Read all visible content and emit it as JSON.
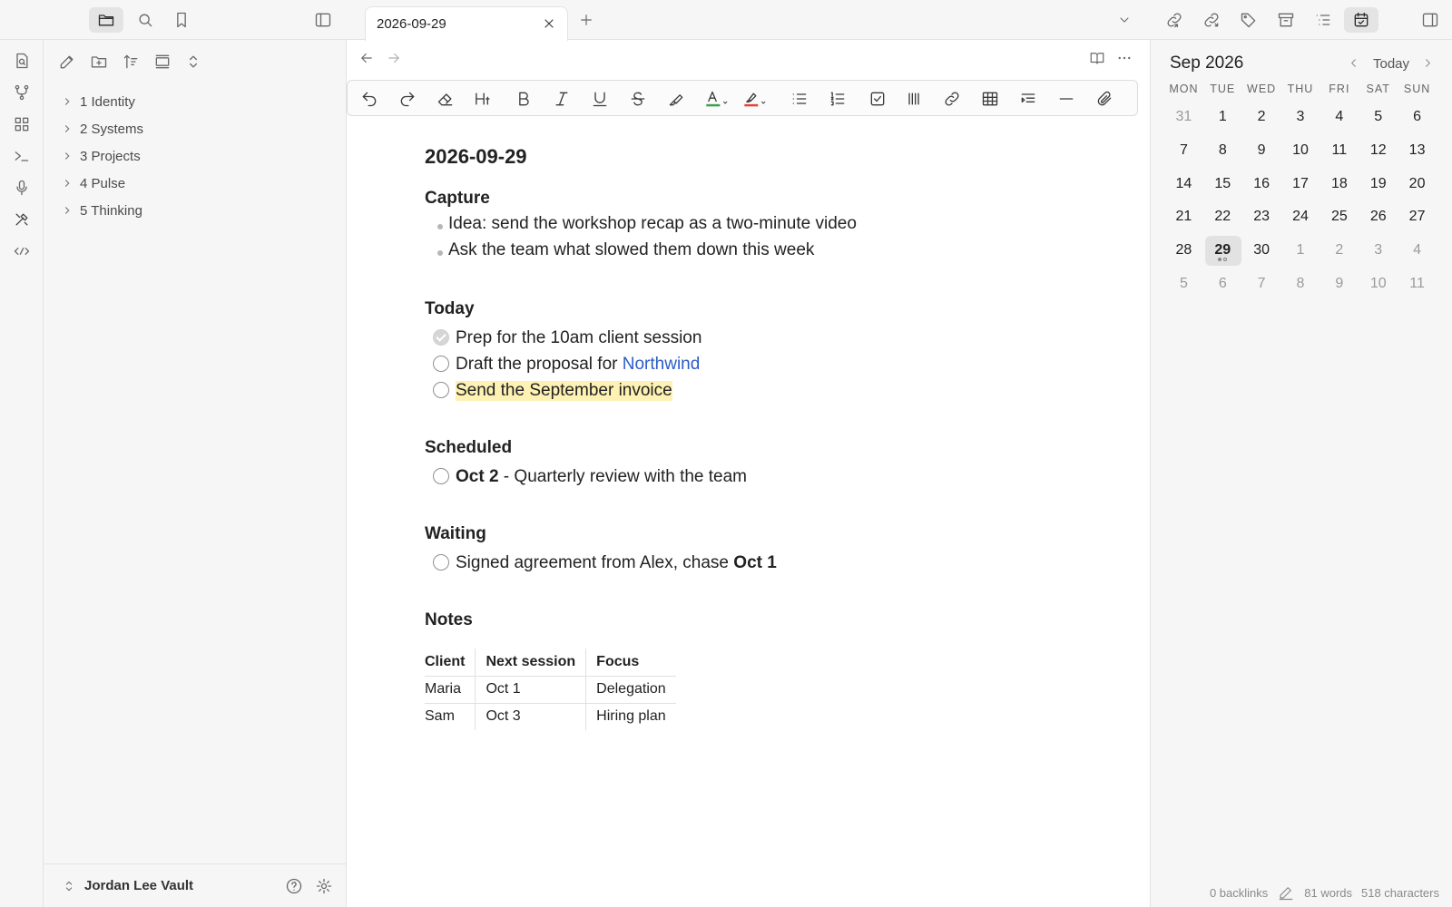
{
  "sidebar": {
    "tree": [
      {
        "label": "1 Identity"
      },
      {
        "label": "2 Systems"
      },
      {
        "label": "3 Projects"
      },
      {
        "label": "4 Pulse"
      },
      {
        "label": "5 Thinking"
      }
    ],
    "vault_name": "Jordan Lee Vault"
  },
  "tab": {
    "title": "2026-09-29"
  },
  "doc": {
    "title": "2026-09-29",
    "capture": {
      "heading": "Capture",
      "items": [
        "Idea: send the workshop recap as a two-minute video",
        "Ask the team what slowed them down this week"
      ]
    },
    "today": {
      "heading": "Today",
      "task1": "Prep for the 10am client session",
      "task2_prefix": "Draft the proposal for ",
      "task2_link": "Northwind",
      "task3": "Send the September invoice"
    },
    "scheduled": {
      "heading": "Scheduled",
      "date": "Oct 2",
      "text": " - Quarterly review with the team"
    },
    "waiting": {
      "heading": "Waiting",
      "text": "Signed agreement from Alex, chase ",
      "date": "Oct 1"
    },
    "notes": {
      "heading": "Notes",
      "headers": [
        "Client",
        "Next session",
        "Focus"
      ],
      "rows": [
        [
          "Maria",
          "Oct 1",
          "Delegation"
        ],
        [
          "Sam",
          "Oct 3",
          "Hiring plan"
        ]
      ]
    }
  },
  "calendar": {
    "month_label": "Sep 2026",
    "today_label": "Today",
    "weekdays": [
      "MON",
      "TUE",
      "WED",
      "THU",
      "FRI",
      "SAT",
      "SUN"
    ],
    "weeks": [
      [
        "31",
        "1",
        "2",
        "3",
        "4",
        "5",
        "6"
      ],
      [
        "7",
        "8",
        "9",
        "10",
        "11",
        "12",
        "13"
      ],
      [
        "14",
        "15",
        "16",
        "17",
        "18",
        "19",
        "20"
      ],
      [
        "21",
        "22",
        "23",
        "24",
        "25",
        "26",
        "27"
      ],
      [
        "28",
        "29",
        "30",
        "1",
        "2",
        "3",
        "4"
      ],
      [
        "5",
        "6",
        "7",
        "8",
        "9",
        "10",
        "11"
      ]
    ],
    "selected_day": "29"
  },
  "status": {
    "backlinks": "0 backlinks",
    "words": "81 words",
    "characters": "518 characters"
  },
  "colors": {
    "link": "#2a5cc7",
    "highlight": "#fdf1b3",
    "text_color_bar": "#3aa34a",
    "highlight_bar": "#e0453a"
  }
}
